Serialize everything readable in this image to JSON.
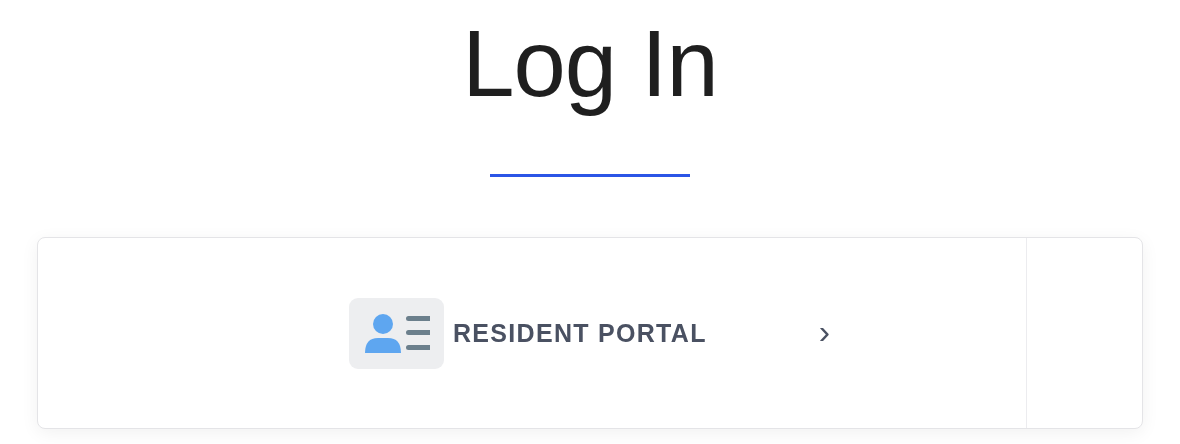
{
  "title": "Log In",
  "portal_link": {
    "label": "RESIDENT PORTAL",
    "chevron": "›"
  }
}
